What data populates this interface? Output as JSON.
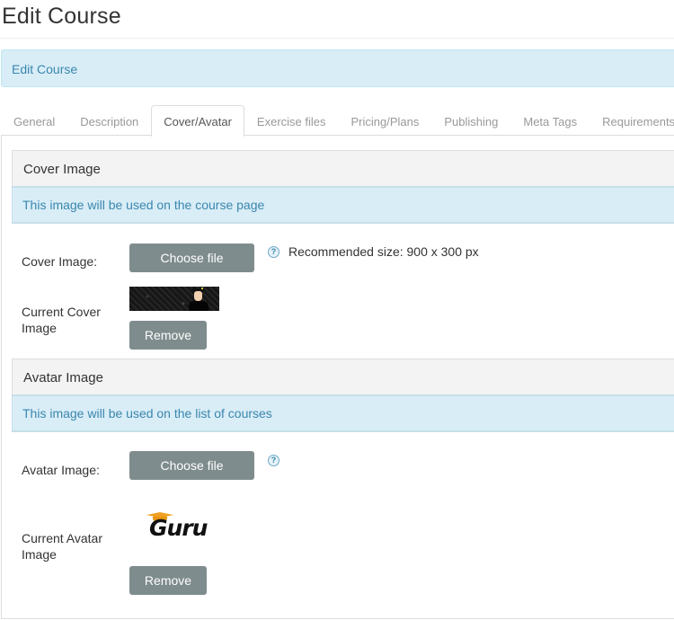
{
  "page": {
    "title": "Edit Course",
    "banner": "Edit Course"
  },
  "tabs": [
    {
      "label": "General",
      "active": false
    },
    {
      "label": "Description",
      "active": false
    },
    {
      "label": "Cover/Avatar",
      "active": true
    },
    {
      "label": "Exercise files",
      "active": false
    },
    {
      "label": "Pricing/Plans",
      "active": false
    },
    {
      "label": "Publishing",
      "active": false
    },
    {
      "label": "Meta Tags",
      "active": false
    },
    {
      "label": "Requirements",
      "active": false
    }
  ],
  "cover": {
    "section_title": "Cover Image",
    "note": "This image will be used on the course page",
    "field_label": "Cover Image:",
    "choose_label": "Choose file",
    "help_icon": "question-circle-icon",
    "help_glyph": "?",
    "help_text": "Recommended size: 900 x 300 px",
    "current_label_line1": "Current Cover",
    "current_label_line2": "Image",
    "remove_label": "Remove"
  },
  "avatar": {
    "section_title": "Avatar Image",
    "note": "This image will be used on the list of courses",
    "field_label": "Avatar Image:",
    "choose_label": "Choose file",
    "help_icon": "question-circle-icon",
    "help_glyph": "?",
    "logo_text": "Guru",
    "current_label_line1": "Current Avatar",
    "current_label_line2": "Image",
    "remove_label": "Remove"
  },
  "colors": {
    "info_bg": "#d9edf7",
    "info_text": "#3a87ad",
    "button_bg": "#7f8c8d",
    "logo_cap": "#f0a020"
  }
}
